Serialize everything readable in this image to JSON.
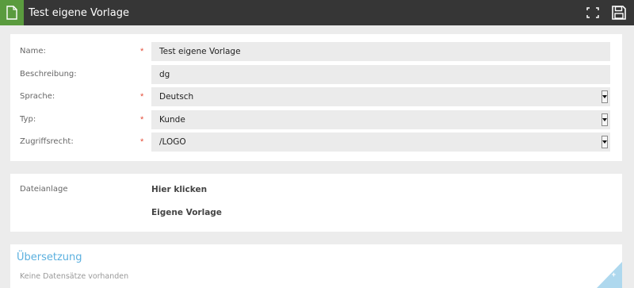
{
  "window": {
    "title": "Test eigene Vorlage",
    "icons": {
      "document": "document-icon",
      "expand": "expand-icon",
      "save": "save-disk-icon"
    }
  },
  "form": {
    "rows": [
      {
        "label": "Name:",
        "required": "*",
        "value": "Test eigene Vorlage",
        "type": "text"
      },
      {
        "label": "Beschreibung:",
        "required": "",
        "value": "dg",
        "type": "text"
      },
      {
        "label": "Sprache:",
        "required": "*",
        "value": "Deutsch",
        "type": "select"
      },
      {
        "label": "Typ:",
        "required": "*",
        "value": "Kunde",
        "type": "select"
      },
      {
        "label": "Zugriffsrecht:",
        "required": "*",
        "value": "/LOGO",
        "type": "select"
      }
    ]
  },
  "attachment": {
    "label": "Dateianlage",
    "link_click": "Hier klicken",
    "link_template": "Eigene Vorlage"
  },
  "translation": {
    "title": "Übersetzung",
    "empty_text": "Keine Datensätze vorhanden",
    "add_label": "+"
  },
  "colors": {
    "titlebar_bg": "#363636",
    "doc_icon_bg": "#5a9b3e",
    "required_star": "#e54f3b",
    "section_title": "#5bb0df",
    "add_corner": "#aed8ee"
  }
}
